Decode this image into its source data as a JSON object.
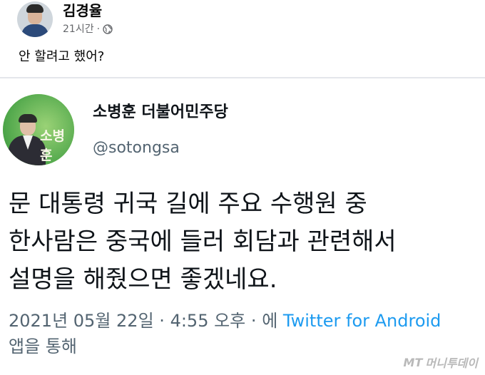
{
  "post": {
    "author_name": "김경율",
    "timestamp": "21시간",
    "separator": "·",
    "privacy_icon": "globe-icon",
    "text": "안 할려고 했어?"
  },
  "tweet": {
    "avatar_logo_text": "소병훈",
    "display_name": "소병훈 더불어민주당",
    "handle": "@sotongsa",
    "body_lines": [
      "문 대통령 귀국 길에 주요 수행원 중",
      "한사람은 중국에 들러 회담과 관련해서",
      "설명을 해줬으면 좋겠네요."
    ],
    "date": "2021년 05월 22일",
    "time": "4:55 오후",
    "dot1": "·",
    "dot2": "·",
    "via_prefix": "에",
    "client": "Twitter for Android",
    "via_suffix": "앱을 통해"
  },
  "watermark": {
    "prefix": "MT",
    "text": "머니투데이"
  },
  "colors": {
    "link": "#1d9bf0",
    "secondary": "#536471",
    "fb_secondary": "#65676b"
  }
}
